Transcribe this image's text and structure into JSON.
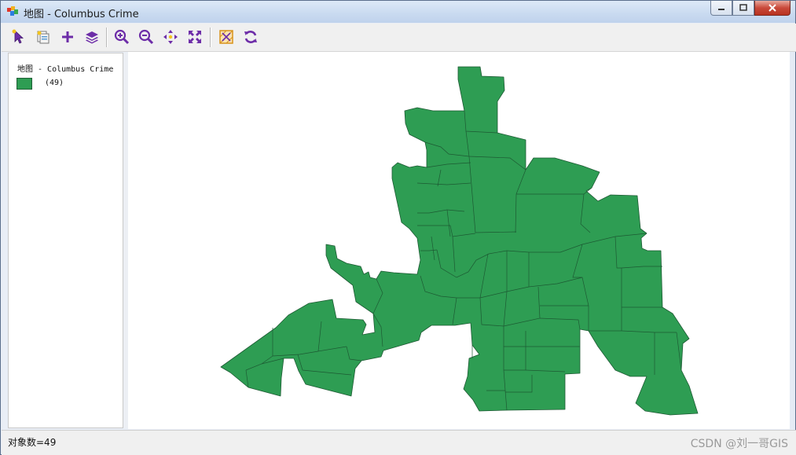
{
  "window": {
    "title": "地图 - Columbus Crime"
  },
  "toolbar": {
    "buttons": [
      {
        "name": "select-tool",
        "icon": "pointer-icon"
      },
      {
        "name": "identify-tool",
        "icon": "identify-icon"
      },
      {
        "name": "add-layer",
        "icon": "plus-icon"
      },
      {
        "name": "layers",
        "icon": "layers-icon"
      },
      {
        "name": "zoom-in",
        "icon": "zoom-in-icon"
      },
      {
        "name": "zoom-out",
        "icon": "zoom-out-icon"
      },
      {
        "name": "pan",
        "icon": "pan-icon"
      },
      {
        "name": "full-extent",
        "icon": "full-extent-icon"
      },
      {
        "name": "clear-selection",
        "icon": "clear-selection-icon"
      },
      {
        "name": "refresh",
        "icon": "refresh-icon"
      }
    ]
  },
  "legend": {
    "title": "地图 - Columbus Crime",
    "count_label": "(49)",
    "fill_color": "#2e9d53"
  },
  "map": {
    "fill_color": "#2e9d53",
    "stroke_color": "#1d5a33",
    "feature_count": 49
  },
  "status": {
    "text": "对象数=49",
    "watermark": "CSDN @刘一哥GIS"
  }
}
